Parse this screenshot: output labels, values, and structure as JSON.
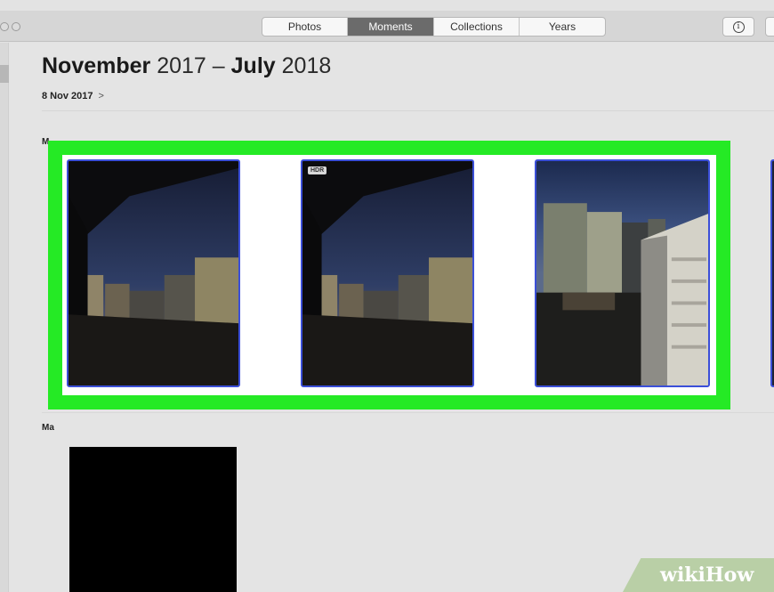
{
  "toolbar": {
    "tabs": [
      {
        "label": "Photos",
        "active": false
      },
      {
        "label": "Moments",
        "active": true
      },
      {
        "label": "Collections",
        "active": false
      },
      {
        "label": "Years",
        "active": false
      }
    ],
    "info_icon": "info-icon",
    "info_glyph": "i"
  },
  "header": {
    "title_bold_start": "November",
    "title_year_start": "2017",
    "title_sep": "–",
    "title_bold_end": "July",
    "title_year_end": "2018",
    "date": "8 Nov 2017",
    "chevron": ">"
  },
  "sections": [
    {
      "label": "M"
    },
    {
      "label": "Ma"
    }
  ],
  "photos": [
    {
      "badge": ""
    },
    {
      "badge": "HDR"
    },
    {
      "badge": ""
    }
  ],
  "colors": {
    "highlight": "#25ea25",
    "selection_border": "#3b4fd8",
    "active_tab": "#6b6b6b"
  },
  "watermark": {
    "text": "wikiHow"
  }
}
